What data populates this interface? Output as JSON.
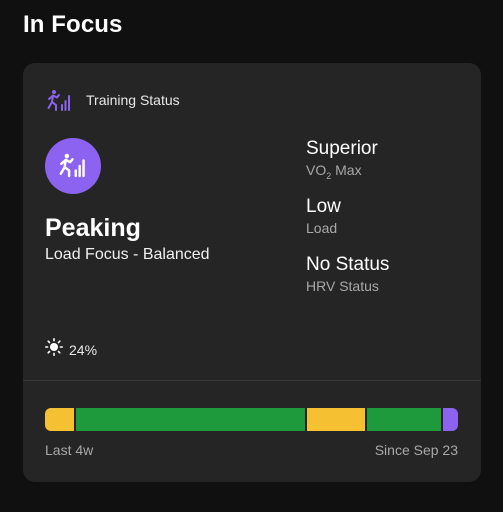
{
  "page": {
    "title": "In Focus"
  },
  "card": {
    "header_label": "Training Status",
    "icon": "training-status-icon",
    "status": {
      "title": "Peaking",
      "subtitle": "Load Focus - Balanced"
    },
    "metrics": [
      {
        "value": "Superior",
        "label_main": "VO",
        "label_sub": "2",
        "label_tail": " Max"
      },
      {
        "value": "Low",
        "label": "Load"
      },
      {
        "value": "No Status",
        "label": "HRV Status"
      }
    ],
    "weather": {
      "icon": "sun-icon",
      "value": "24%"
    },
    "load_bar": {
      "segments": [
        {
          "color": "#f5c133",
          "weight": 7
        },
        {
          "color": "#1e9a3c",
          "weight": 55
        },
        {
          "color": "#f5c133",
          "weight": 14
        },
        {
          "color": "#1e9a3c",
          "weight": 18
        },
        {
          "color": "#8b63f0",
          "weight": 3.5
        }
      ]
    },
    "footer": {
      "left": "Last 4w",
      "right": "Since Sep 23"
    }
  },
  "colors": {
    "accent_purple": "#8b63f0",
    "background": "#101010",
    "card": "#252525"
  }
}
